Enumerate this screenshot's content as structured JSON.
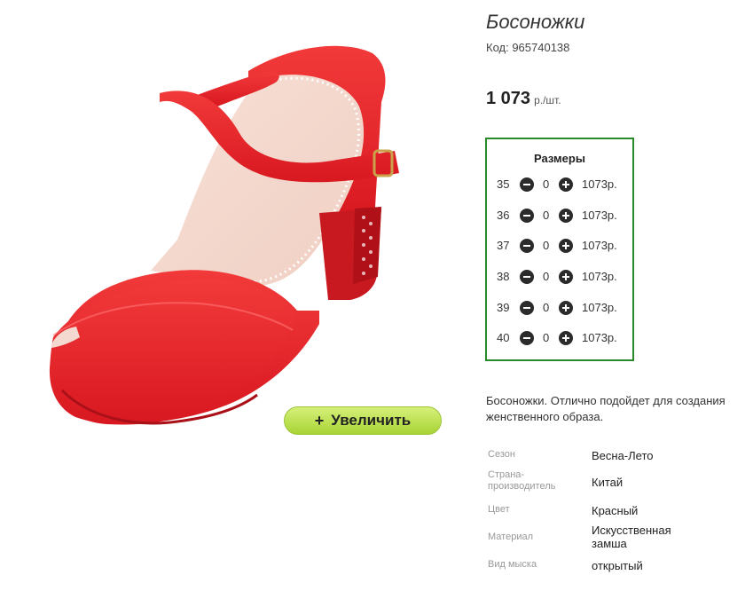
{
  "product": {
    "title": "Босоножки",
    "sku": "Код: 965740138",
    "price_value": "1 073",
    "price_unit": "р./шт.",
    "image_icon": "red-sandal-image"
  },
  "zoom_button": {
    "plus": "+",
    "label": "Увеличить"
  },
  "sizes": {
    "title": "Размеры",
    "rows": [
      {
        "size": "35",
        "qty": "0",
        "price": "1073р."
      },
      {
        "size": "36",
        "qty": "0",
        "price": "1073р."
      },
      {
        "size": "37",
        "qty": "0",
        "price": "1073р."
      },
      {
        "size": "38",
        "qty": "0",
        "price": "1073р."
      },
      {
        "size": "39",
        "qty": "0",
        "price": "1073р."
      },
      {
        "size": "40",
        "qty": "0",
        "price": "1073р."
      }
    ]
  },
  "description": "Босоножки. Отлично подойдет для создания женственного образа.",
  "attributes": [
    {
      "label": "Сезон",
      "value": "Весна-Лето"
    },
    {
      "label": "Страна-\nпроизводитель",
      "value": "Китай"
    },
    {
      "label": "Цвет",
      "value": "Красный"
    },
    {
      "label": "Материал",
      "value": "Искусственная\nзамша"
    },
    {
      "label": "Вид мыска",
      "value": "открытый"
    }
  ],
  "colors": {
    "frame": "#2a8a2a",
    "button_top": "#d6f07a",
    "button_bottom": "#a8d434",
    "shoe": "#e8242c"
  }
}
